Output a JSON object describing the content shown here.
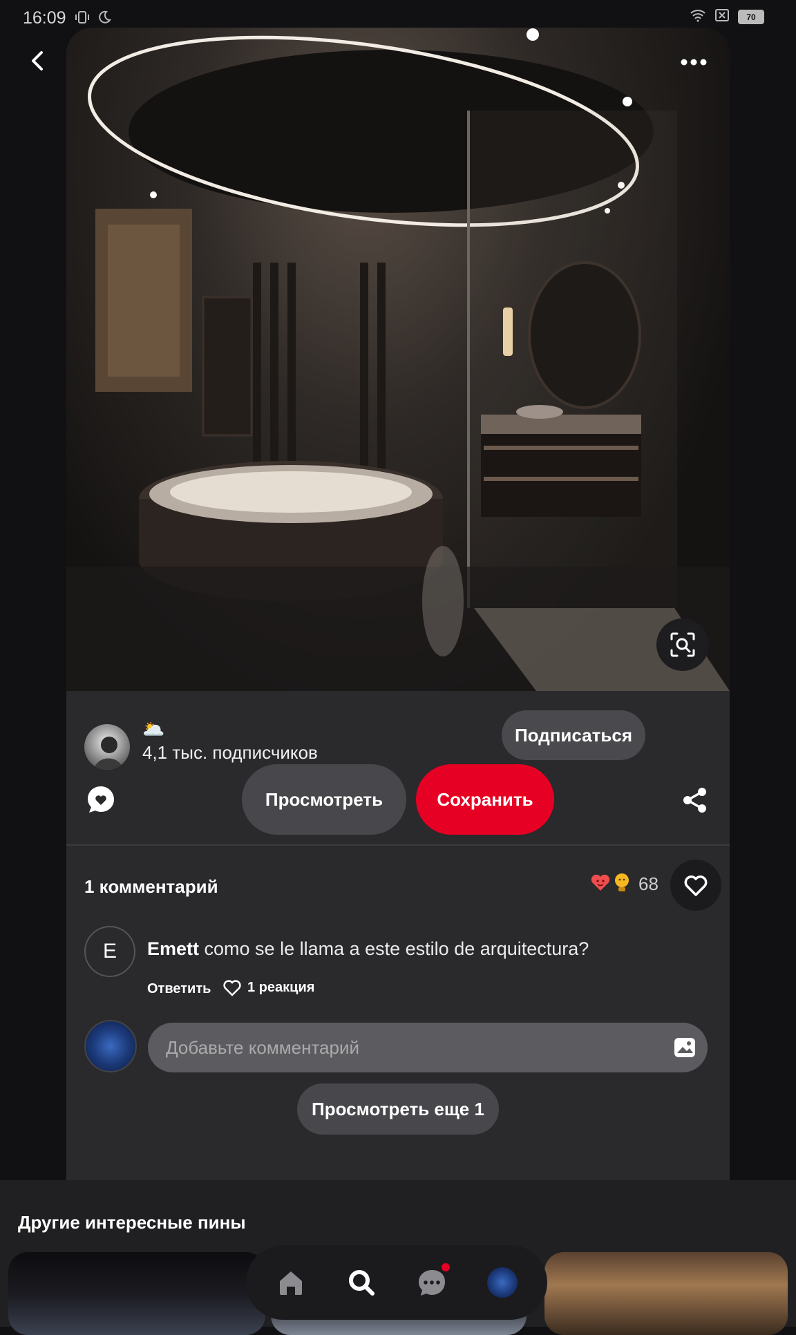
{
  "status_bar": {
    "time": "16:09",
    "battery": "70",
    "icons": [
      "vibrate-icon",
      "moon-icon",
      "wifi-icon",
      "no-sim-icon",
      "battery-icon"
    ]
  },
  "pin": {
    "image_alt": "dark luxury bathroom interior",
    "author_emoji": "🌥️",
    "followers": "4,1 тыс. подписчиков",
    "follow_label": "Подписаться",
    "view_label": "Просмотреть",
    "save_label": "Сохранить"
  },
  "comments": {
    "title": "1 комментарий",
    "reaction_count": "68",
    "items": [
      {
        "avatar_letter": "E",
        "author": "Emett",
        "text": "como se le llama a este estilo de arquitectura?",
        "reply_label": "Ответить",
        "reactions_label": "1 реакция"
      }
    ],
    "input_placeholder": "Добавьте комментарий",
    "more_label": "Просмотреть еще 1"
  },
  "more_pins": {
    "title": "Другие интересные пины"
  },
  "nav": {
    "items": [
      "home-icon",
      "search-icon",
      "messages-icon",
      "profile-avatar"
    ]
  },
  "colors": {
    "accent": "#e60023",
    "card": "#2a292c",
    "background": "#111114"
  }
}
